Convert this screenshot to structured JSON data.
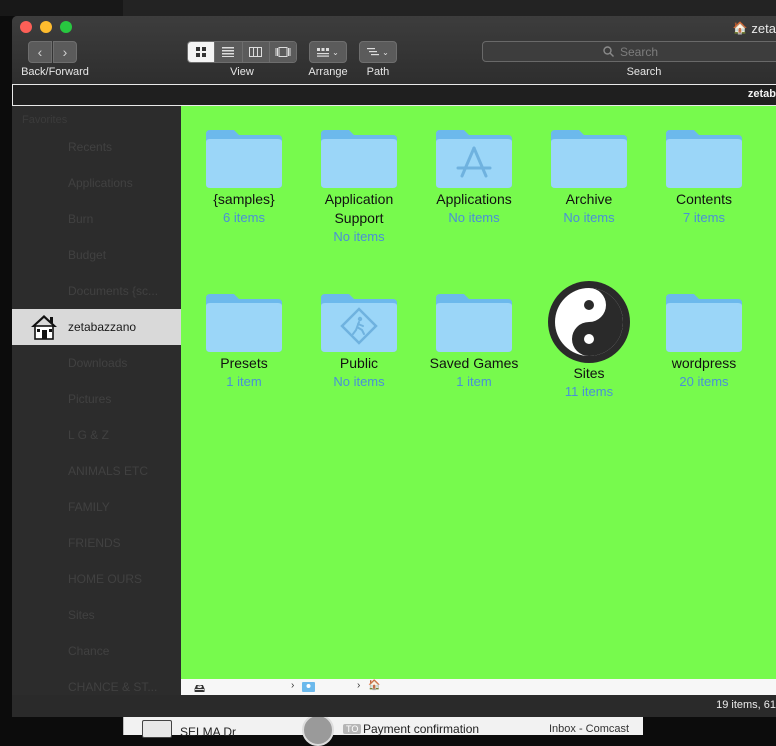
{
  "background": {
    "folder_label": "SELMA Dr",
    "mail_tag": "TO",
    "mail_subject": "Payment confirmation",
    "mail_source": "Inbox - Comcast"
  },
  "window": {
    "title": "zeta"
  },
  "toolbar": {
    "back_forward_label": "Back/Forward",
    "view_label": "View",
    "arrange_label": "Arrange",
    "path_label": "Path",
    "search_label": "Search",
    "search_placeholder": "Search"
  },
  "path_bar": {
    "text": "zetab"
  },
  "sidebar": {
    "heading": "Favorites",
    "items": [
      {
        "label": "Recents"
      },
      {
        "label": "Applications"
      },
      {
        "label": "Burn"
      },
      {
        "label": "Budget"
      },
      {
        "label": "Documents {sc..."
      },
      {
        "label": "zetabazzano"
      },
      {
        "label": "Downloads"
      },
      {
        "label": "Pictures"
      },
      {
        "label": "L G & Z"
      },
      {
        "label": "ANIMALS ETC"
      },
      {
        "label": "FAMILY"
      },
      {
        "label": "FRIENDS"
      },
      {
        "label": "HOME OURS"
      },
      {
        "label": "Sites"
      },
      {
        "label": "Chance"
      },
      {
        "label": "CHANCE & ST..."
      }
    ]
  },
  "items": [
    {
      "name": "{samples}",
      "count": "6 items"
    },
    {
      "name": "Application",
      "name2": "Support",
      "count": "No items"
    },
    {
      "name": "Applications",
      "count": "No items"
    },
    {
      "name": "Archive",
      "count": "No items"
    },
    {
      "name": "Contents",
      "count": "7 items"
    },
    {
      "name": "Presets",
      "count": "1 item"
    },
    {
      "name": "Public",
      "count": "No items"
    },
    {
      "name": "Saved Games",
      "count": "1 item"
    },
    {
      "name": "Sites",
      "count": "11 items"
    },
    {
      "name": "wordpress",
      "count": "20 items"
    }
  ],
  "status": {
    "text": "19 items, 61"
  },
  "colors": {
    "content_background": "#77fa4d",
    "folder_blue": "#8ccff5",
    "count_blue": "#4a8fd8"
  }
}
